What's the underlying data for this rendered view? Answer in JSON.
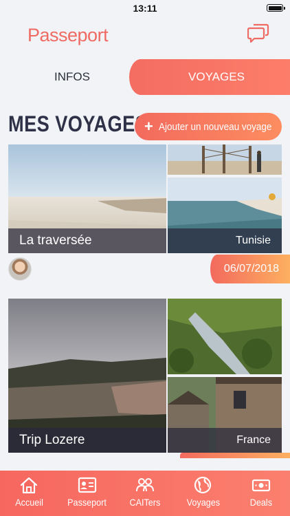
{
  "status": {
    "time": "13:11"
  },
  "header": {
    "title": "Passeport",
    "chat_icon": "chat-bubbles-icon"
  },
  "tabs": [
    {
      "label": "INFOS",
      "active": false
    },
    {
      "label": "VOYAGES",
      "active": true
    }
  ],
  "section": {
    "title": "MES VOYAGES",
    "add_button_label": "Ajouter un nouveau voyage"
  },
  "trips": [
    {
      "title": "La traversée",
      "country": "Tunisie",
      "date": "06/07/2018"
    },
    {
      "title": "Trip Lozere",
      "country": "France"
    }
  ],
  "bottom_nav": [
    {
      "label": "Accueil",
      "icon": "home-icon"
    },
    {
      "label": "Passeport",
      "icon": "id-card-icon"
    },
    {
      "label": "CAITers",
      "icon": "people-icon"
    },
    {
      "label": "Voyages",
      "icon": "globe-icon"
    },
    {
      "label": "Deals",
      "icon": "money-icon"
    }
  ],
  "colors": {
    "accent": "#f46d62",
    "title_dark": "#2e3147"
  }
}
